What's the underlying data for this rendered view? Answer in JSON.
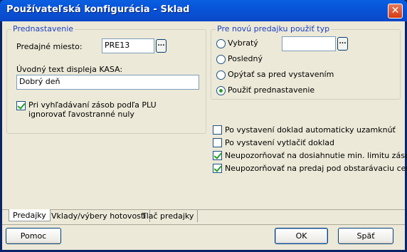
{
  "window": {
    "title": "Používateľská konfigurácia - Sklad",
    "close_glyph": "✕"
  },
  "left_group": {
    "legend": "Prednastavenie",
    "sale_point_label": "Predajné miesto:",
    "sale_point_value": "PRE13",
    "display_text_label": "Úvodný text displeja KASA:",
    "display_text_value": "Dobrý deň",
    "ignore_zeros_checked": true,
    "ignore_zeros_label_1": "Pri vyhľadávaní zásob podľa PLU",
    "ignore_zeros_label_2": "ignorovať ľavostranné nuly"
  },
  "right_group": {
    "legend": "Pre novú predajku použiť typ",
    "radios": [
      {
        "label": "Vybratý",
        "checked": false
      },
      {
        "label": "Posledný",
        "checked": false
      },
      {
        "label": "Opýtať sa pred vystavením",
        "checked": false
      },
      {
        "label": "Použiť prednastavenie",
        "checked": true
      }
    ],
    "selected_type_value": ""
  },
  "options": [
    {
      "label": "Po vystavení doklad automaticky uzamknúť",
      "checked": false
    },
    {
      "label": "Po vystavení vytlačiť doklad",
      "checked": false
    },
    {
      "label": "Neupozorňovať na dosiahnutie min. limitu zásob",
      "checked": true
    },
    {
      "label": "Neupozorňovať na predaj pod obstarávaciu cenu",
      "checked": true
    }
  ],
  "tabs": [
    {
      "label": "Predajky",
      "active": true
    },
    {
      "label": "Vklady/výbery hotovosti",
      "active": false
    },
    {
      "label": "Tlač predajky",
      "active": false
    }
  ],
  "buttons": {
    "help": "Pomoc",
    "ok": "OK",
    "back": "Späť",
    "ellipsis": "..."
  },
  "icons": [
    "close-icon",
    "ellipsis-icon",
    "checkmark-icon",
    "radio-dot-icon"
  ]
}
